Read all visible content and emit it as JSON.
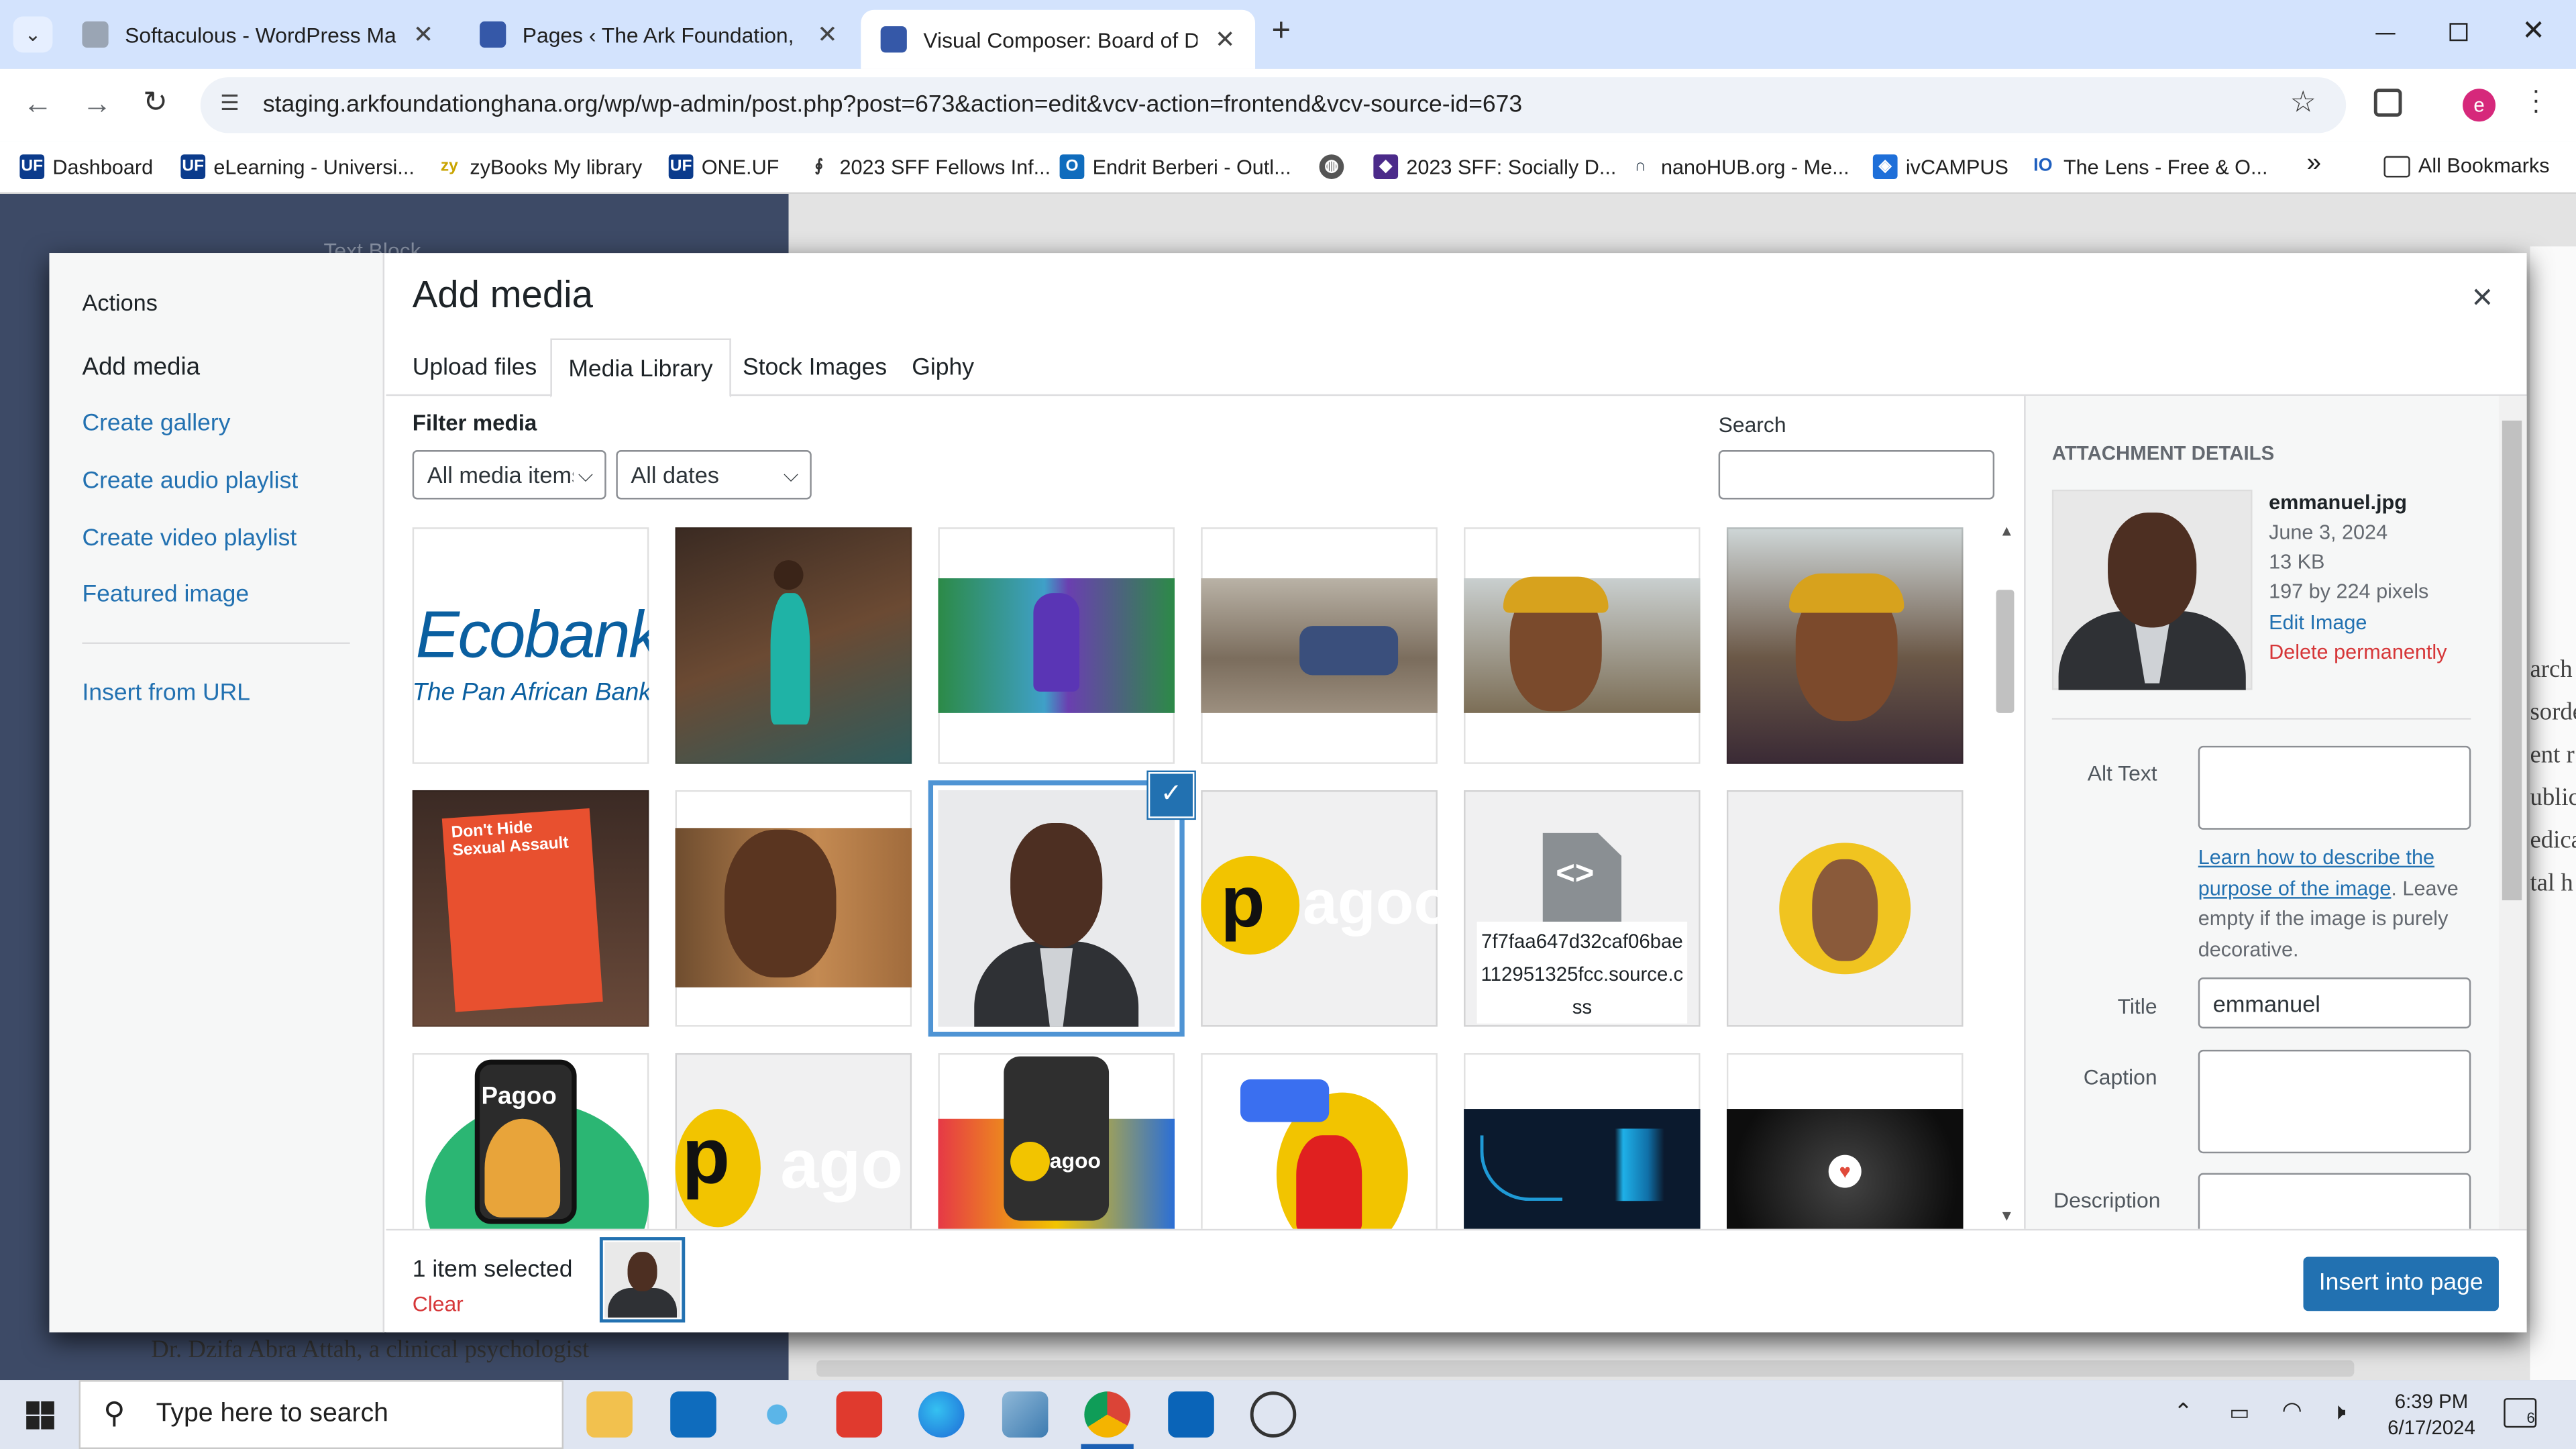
{
  "browser": {
    "tabs": [
      {
        "title": "Softaculous - WordPress Manag",
        "close": "✕"
      },
      {
        "title": "Pages ‹ The Ark Foundation, Gh",
        "close": "✕"
      },
      {
        "title": "Visual Composer: Board of Dire",
        "close": "✕"
      }
    ],
    "new_tab": "+",
    "url": "staging.arkfoundationghana.org/wp/wp-admin/post.php?post=673&action=edit&vcv-action=frontend&vcv-source-id=673",
    "bookmarks": [
      "Dashboard",
      "eLearning - Universi...",
      "zyBooks My library",
      "ONE.UF",
      "2023 SFF Fellows Inf...",
      "Endrit Berberi - Outl...",
      "",
      "2023 SFF: Socially D...",
      "nanoHUB.org - Me...",
      "ivCAMPUS",
      "The Lens - Free & O..."
    ],
    "more": "»",
    "all_bookmarks": "All Bookmarks",
    "profile_initial": "e"
  },
  "background": {
    "text_block_label": "Text Block",
    "paragraph": "Dr. Dzifa Abra Attah, a clinical psychologist",
    "side_fragments": [
      "arch",
      "sorde",
      "ent r",
      "ublic",
      "edica",
      "tal h"
    ]
  },
  "modal": {
    "actions_heading": "Actions",
    "menu": [
      "Add media",
      "Create gallery",
      "Create audio playlist",
      "Create video playlist",
      "Featured image",
      "Insert from URL"
    ],
    "title": "Add media",
    "close": "×",
    "tabs": [
      "Upload files",
      "Media Library",
      "Stock Images",
      "Giphy"
    ],
    "active_tab": "Media Library",
    "filter_label": "Filter media",
    "type_filter": "All media items",
    "date_filter": "All dates",
    "search_label": "Search",
    "search_value": "",
    "grid": [
      {
        "name": "ecobank-logo",
        "kind": "ecobank",
        "line1": "Ecobank",
        "line2": "The Pan African Bank"
      },
      {
        "name": "girl-dancing",
        "kind": "photo"
      },
      {
        "name": "painting-woman",
        "kind": "photo"
      },
      {
        "name": "group-meeting",
        "kind": "photo"
      },
      {
        "name": "woman-portrait-1",
        "kind": "photo"
      },
      {
        "name": "woman-portrait-2",
        "kind": "photo"
      },
      {
        "name": "poster-sexual-assault",
        "kind": "poster",
        "text": "Don't Hide Sexual Assault"
      },
      {
        "name": "smiling-child",
        "kind": "photo"
      },
      {
        "name": "emmanuel",
        "kind": "portrait",
        "selected": true
      },
      {
        "name": "pagoo-logo",
        "kind": "pagoo",
        "text": "agoo"
      },
      {
        "name": "css-file",
        "kind": "file",
        "text": "7f7faa647d32caf06bae112951325fcc.source.css"
      },
      {
        "name": "woman-yellow-circle",
        "kind": "photo"
      },
      {
        "name": "pagoo-app-1",
        "kind": "promo",
        "text": "Pagoo"
      },
      {
        "name": "pagoo-logo-2",
        "kind": "pagoo",
        "text": "ago"
      },
      {
        "name": "pagoo-app-2",
        "kind": "promo",
        "text": "agoo"
      },
      {
        "name": "man-red-illustration",
        "kind": "photo"
      },
      {
        "name": "dashboard-chart",
        "kind": "dark"
      },
      {
        "name": "heart-dark",
        "kind": "dark2"
      }
    ],
    "details": {
      "heading": "Attachment Details",
      "filename": "emmanuel.jpg",
      "date": "June 3, 2024",
      "size": "13 KB",
      "dimensions": "197 by 224 pixels",
      "edit": "Edit Image",
      "delete": "Delete permanently",
      "alt_label": "Alt Text",
      "alt_value": "",
      "help_link": "Learn how to describe the purpose of the image",
      "help_text": ". Leave empty if the image is purely decorative.",
      "title_label": "Title",
      "title_value": "emmanuel",
      "caption_label": "Caption",
      "caption_value": "",
      "description_label": "Description",
      "description_value": ""
    },
    "selection": {
      "count": "1 item selected",
      "clear": "Clear"
    },
    "insert_button": "Insert into page"
  },
  "taskbar": {
    "search_placeholder": "Type here to search",
    "time": "6:39 PM",
    "date": "6/17/2024",
    "notifications": "6"
  },
  "colors": {
    "accent": "#2271b1",
    "danger": "#d63638",
    "tab_strip": "#d3e3fd"
  }
}
